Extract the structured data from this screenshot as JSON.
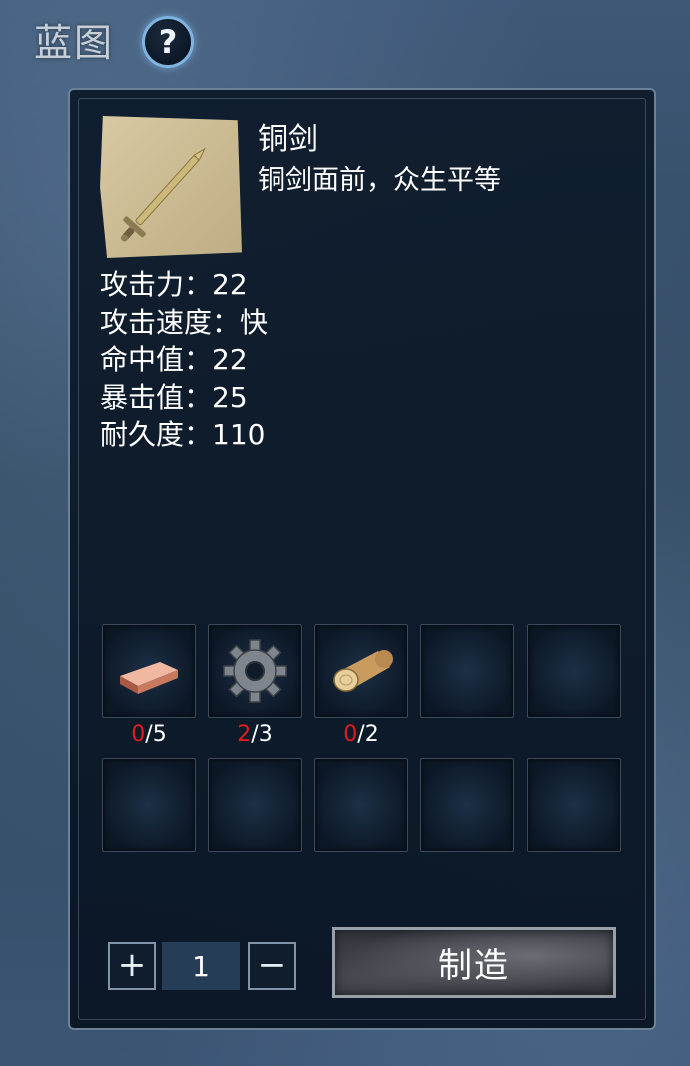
{
  "header": {
    "title": "蓝图",
    "help_label": "?"
  },
  "item": {
    "name": "铜剑",
    "description": "铜剑面前，众生平等",
    "icon": "bronze-sword-icon",
    "stats": [
      "攻击力：22",
      "攻击速度：快",
      "命中值：22",
      "暴击值：25",
      "耐久度：110"
    ]
  },
  "materials": [
    {
      "icon": "copper-ingot-icon",
      "have": "0",
      "need": "/5"
    },
    {
      "icon": "gear-icon",
      "have": "2",
      "need": "/3"
    },
    {
      "icon": "wood-log-icon",
      "have": "0",
      "need": "/2"
    }
  ],
  "quantity": {
    "plus_label": "+",
    "value": "1",
    "minus_label": "−"
  },
  "craft": {
    "label": "制造"
  },
  "colors": {
    "missing": "#e21b1b",
    "accent": "#7fb3e0"
  }
}
